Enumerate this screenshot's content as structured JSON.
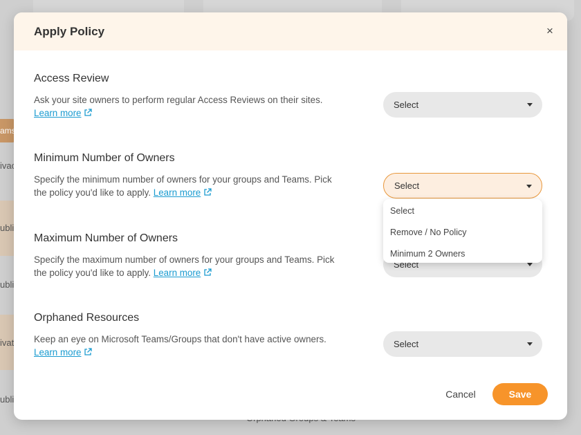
{
  "background": {
    "tag_label": "ams",
    "row_labels": [
      "ivac",
      "ublic",
      "ublic",
      "ivat",
      "ublic"
    ],
    "footer_label": "Orphaned Groups & Teams"
  },
  "modal": {
    "title": "Apply Policy",
    "close_symbol": "×",
    "sections": [
      {
        "title": "Access Review",
        "description": "Ask your site owners to perform regular Access Reviews on their sites.",
        "link": "Learn more",
        "select_value": "Select"
      },
      {
        "title": "Minimum Number of Owners",
        "description": "Specify the minimum number of owners for your groups and Teams. Pick the policy you'd like to apply.",
        "link": "Learn more",
        "select_value": "Select"
      },
      {
        "title": "Maximum Number of Owners",
        "description": "Specify the maximum number of owners for your groups and Teams. Pick the policy you'd like to apply.",
        "link": "Learn more",
        "select_value": "Select"
      },
      {
        "title": "Orphaned Resources",
        "description": "Keep an eye on Microsoft Teams/Groups that don't have active owners.",
        "link": "Learn more",
        "select_value": "Select"
      }
    ],
    "dropdown_options": [
      "Select",
      "Remove / No Policy",
      "Minimum 2 Owners"
    ],
    "cancel_label": "Cancel",
    "save_label": "Save"
  },
  "colors": {
    "accent": "#f7942a",
    "link": "#1a9bd0",
    "header_bg": "#fef5ea"
  }
}
